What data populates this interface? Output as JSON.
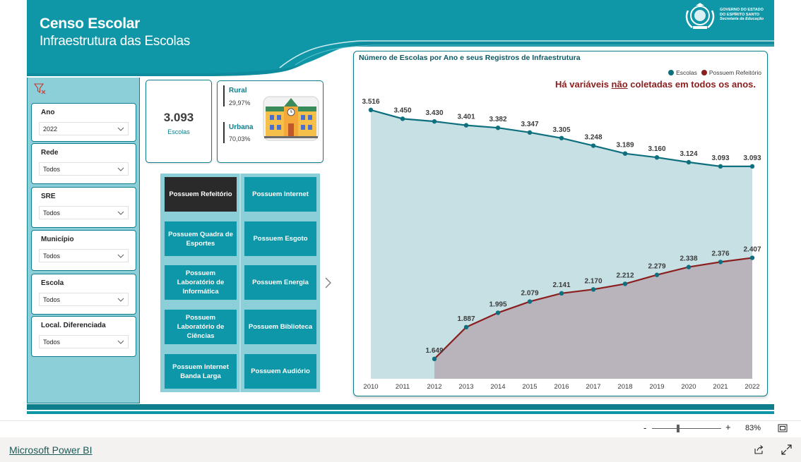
{
  "header": {
    "title": "Censo Escolar",
    "subtitle": "Infraestrutura das Escolas",
    "gov_line1": "GOVERNO DO ESTADO",
    "gov_line2": "DO ESPÍRITO SANTO",
    "gov_line3": "Secretaria da Educação"
  },
  "colors": {
    "teal_dark": "#0e7d8c",
    "teal": "#0e97a8",
    "teal_light": "#8ccfd8",
    "maroon": "#8b1e1e",
    "active_button": "#2a2a2a"
  },
  "filters": [
    {
      "label": "Ano",
      "value": "2022"
    },
    {
      "label": "Rede",
      "value": "Todos"
    },
    {
      "label": "SRE",
      "value": "Todos"
    },
    {
      "label": "Município",
      "value": "Todos"
    },
    {
      "label": "Escola",
      "value": "Todos"
    },
    {
      "label": "Local. Diferenciada",
      "value": "Todos"
    }
  ],
  "kpi": {
    "value": "3.093",
    "label": "Escolas"
  },
  "location": {
    "rural_label": "Rural",
    "rural_pct": "29,97%",
    "urban_label": "Urbana",
    "urban_pct": "70,03%",
    "icon": "school-building-icon"
  },
  "buttons": [
    "Possuem Refeitório",
    "Possuem Internet",
    "Possuem Quadra de Esportes",
    "Possuem Esgoto",
    "Possuem Laboratório de Informática",
    "Possuem Energia",
    "Possuem Laboratório de Ciências",
    "Possuem Biblioteca",
    "Possuem Internet Banda Larga",
    "Possuem Audiório"
  ],
  "active_button_index": 0,
  "chart": {
    "title": "Número de Escolas por Ano e seus Registros de Infraestrutura",
    "note_pre": "Há variáveis ",
    "note_under": "não",
    "note_post": " coletadas em todos os anos.",
    "legend": [
      "Escolas",
      "Possuem Refeitório"
    ]
  },
  "chart_data": {
    "type": "area",
    "title": "Número de Escolas por Ano e seus Registros de Infraestrutura",
    "categories": [
      "2010",
      "2011",
      "2012",
      "2013",
      "2014",
      "2015",
      "2016",
      "2017",
      "2018",
      "2019",
      "2020",
      "2021",
      "2022"
    ],
    "series": [
      {
        "name": "Escolas",
        "color": "#0e6f7e",
        "values": [
          3516,
          3450,
          3430,
          3401,
          3382,
          3347,
          3305,
          3248,
          3189,
          3160,
          3124,
          3093,
          3093
        ],
        "labels": [
          "3.516",
          "3.450",
          "3.430",
          "3.401",
          "3.382",
          "3.347",
          "3.305",
          "3.248",
          "3.189",
          "3.160",
          "3.124",
          "3.093",
          "3.093"
        ]
      },
      {
        "name": "Possuem Refeitório",
        "color": "#8b1e1e",
        "values": [
          null,
          null,
          1649,
          1887,
          1995,
          2079,
          2141,
          2170,
          2212,
          2279,
          2338,
          2376,
          2407
        ],
        "labels": [
          null,
          null,
          "1.649",
          "1.887",
          "1.995",
          "2.079",
          "2.141",
          "2.170",
          "2.212",
          "2.279",
          "2.338",
          "2.376",
          "2.407"
        ]
      }
    ],
    "ylim": [
      1500,
      3600
    ],
    "legend_position": "top-right"
  },
  "footer": {
    "zoom_minus": "-",
    "zoom_plus": "+",
    "zoom_level": "83%",
    "zoom_fraction": 0.38,
    "link": "Microsoft Power BI"
  }
}
